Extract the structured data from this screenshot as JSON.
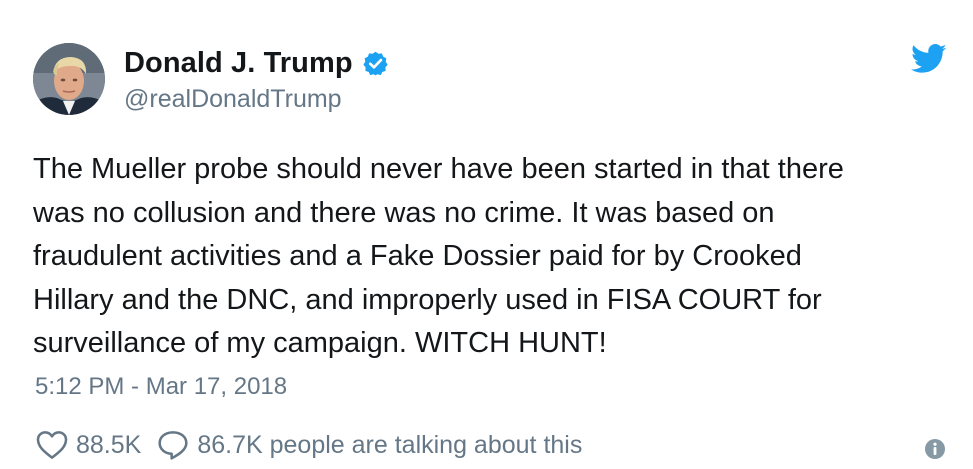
{
  "author": {
    "display_name": "Donald J. Trump",
    "handle": "@realDonaldTrump",
    "verified": true,
    "avatar_icon": "profile-photo",
    "verified_icon": "verified-badge-icon"
  },
  "tweet": {
    "text": "The Mueller probe should never have been started in that there\nwas no collusion and there was no crime. It was based on\nfraudulent activities and a Fake Dossier paid for by Crooked\nHillary and the DNC, and improperly used in FISA COURT for\nsurveillance of my campaign. WITCH HUNT!",
    "timestamp": "5:12 PM - Mar 17, 2018"
  },
  "actions": {
    "like_count": "88.5K",
    "reply_text": "86.7K people are talking about this",
    "like_icon": "heart-icon",
    "reply_icon": "speech-bubble-icon",
    "info_icon": "info-icon"
  },
  "brand": {
    "logo_icon": "twitter-bird-icon",
    "accent_color": "#1da1f2",
    "secondary_text_color": "#657786",
    "primary_text_color": "#14171a"
  }
}
